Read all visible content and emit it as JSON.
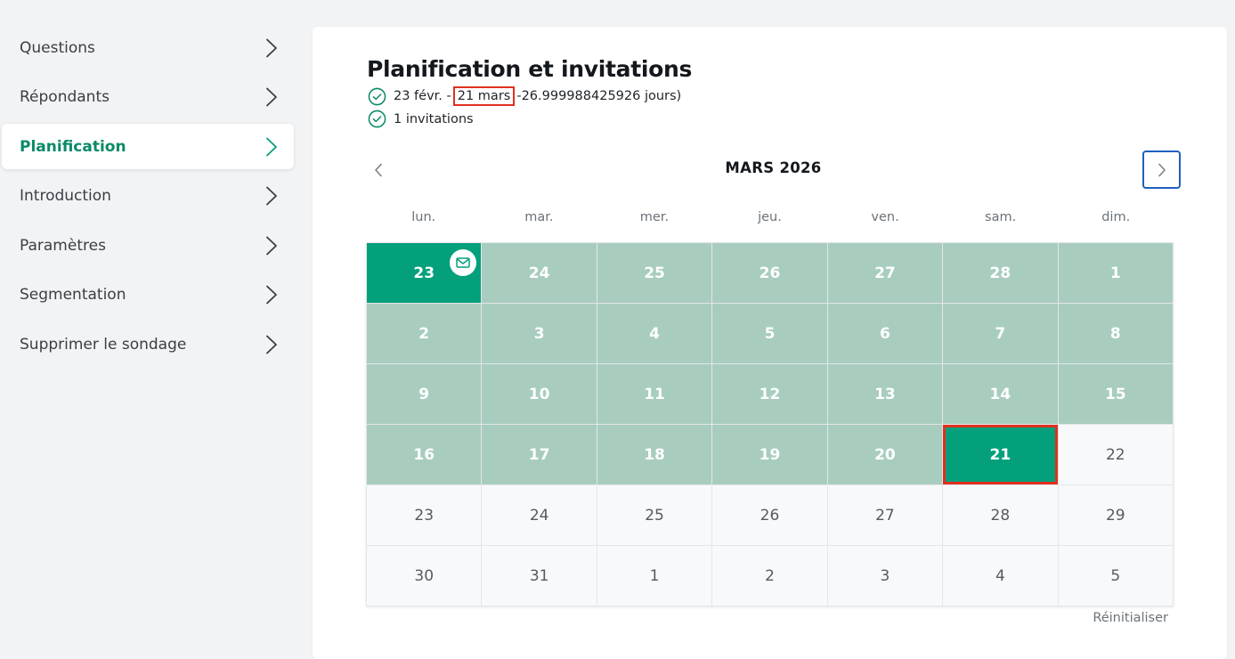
{
  "sidebar": {
    "items": [
      {
        "label": "Questions",
        "active": false
      },
      {
        "label": "Répondants",
        "active": false
      },
      {
        "label": "Planification",
        "active": true
      },
      {
        "label": "Introduction",
        "active": false
      },
      {
        "label": "Paramètres",
        "active": false
      },
      {
        "label": "Segmentation",
        "active": false
      },
      {
        "label": "Supprimer le sondage",
        "active": false
      }
    ]
  },
  "main": {
    "title": "Planification et invitations",
    "range": {
      "start": "23 févr. -",
      "end": "21 mars",
      "duration": "-26.999988425926 jours)"
    },
    "invitations": "1 invitations",
    "calendar": {
      "month": "MARS 2026",
      "weekdays": [
        "lun.",
        "mar.",
        "mer.",
        "jeu.",
        "ven.",
        "sam.",
        "dim."
      ],
      "days": [
        {
          "n": "23",
          "state": "start",
          "mail": true
        },
        {
          "n": "24",
          "state": "in-range"
        },
        {
          "n": "25",
          "state": "in-range"
        },
        {
          "n": "26",
          "state": "in-range"
        },
        {
          "n": "27",
          "state": "in-range"
        },
        {
          "n": "28",
          "state": "in-range"
        },
        {
          "n": "1",
          "state": "in-range"
        },
        {
          "n": "2",
          "state": "in-range"
        },
        {
          "n": "3",
          "state": "in-range"
        },
        {
          "n": "4",
          "state": "in-range"
        },
        {
          "n": "5",
          "state": "in-range"
        },
        {
          "n": "6",
          "state": "in-range"
        },
        {
          "n": "7",
          "state": "in-range"
        },
        {
          "n": "8",
          "state": "in-range"
        },
        {
          "n": "9",
          "state": "in-range"
        },
        {
          "n": "10",
          "state": "in-range"
        },
        {
          "n": "11",
          "state": "in-range"
        },
        {
          "n": "12",
          "state": "in-range"
        },
        {
          "n": "13",
          "state": "in-range"
        },
        {
          "n": "14",
          "state": "in-range"
        },
        {
          "n": "15",
          "state": "in-range"
        },
        {
          "n": "16",
          "state": "in-range"
        },
        {
          "n": "17",
          "state": "in-range"
        },
        {
          "n": "18",
          "state": "in-range"
        },
        {
          "n": "19",
          "state": "in-range"
        },
        {
          "n": "20",
          "state": "in-range"
        },
        {
          "n": "21",
          "state": "end"
        },
        {
          "n": "22",
          "state": "empty"
        },
        {
          "n": "23",
          "state": "empty"
        },
        {
          "n": "24",
          "state": "empty"
        },
        {
          "n": "25",
          "state": "empty"
        },
        {
          "n": "26",
          "state": "empty"
        },
        {
          "n": "27",
          "state": "empty"
        },
        {
          "n": "28",
          "state": "empty"
        },
        {
          "n": "29",
          "state": "empty"
        },
        {
          "n": "30",
          "state": "empty"
        },
        {
          "n": "31",
          "state": "empty"
        },
        {
          "n": "1",
          "state": "empty"
        },
        {
          "n": "2",
          "state": "empty"
        },
        {
          "n": "3",
          "state": "empty"
        },
        {
          "n": "4",
          "state": "empty"
        },
        {
          "n": "5",
          "state": "empty"
        }
      ]
    },
    "reset_label": "Réinitialiser"
  },
  "colors": {
    "accent": "#03a07b",
    "range": "#a8cdbf",
    "highlight": "#e0301e",
    "focus": "#1f5fbf"
  }
}
